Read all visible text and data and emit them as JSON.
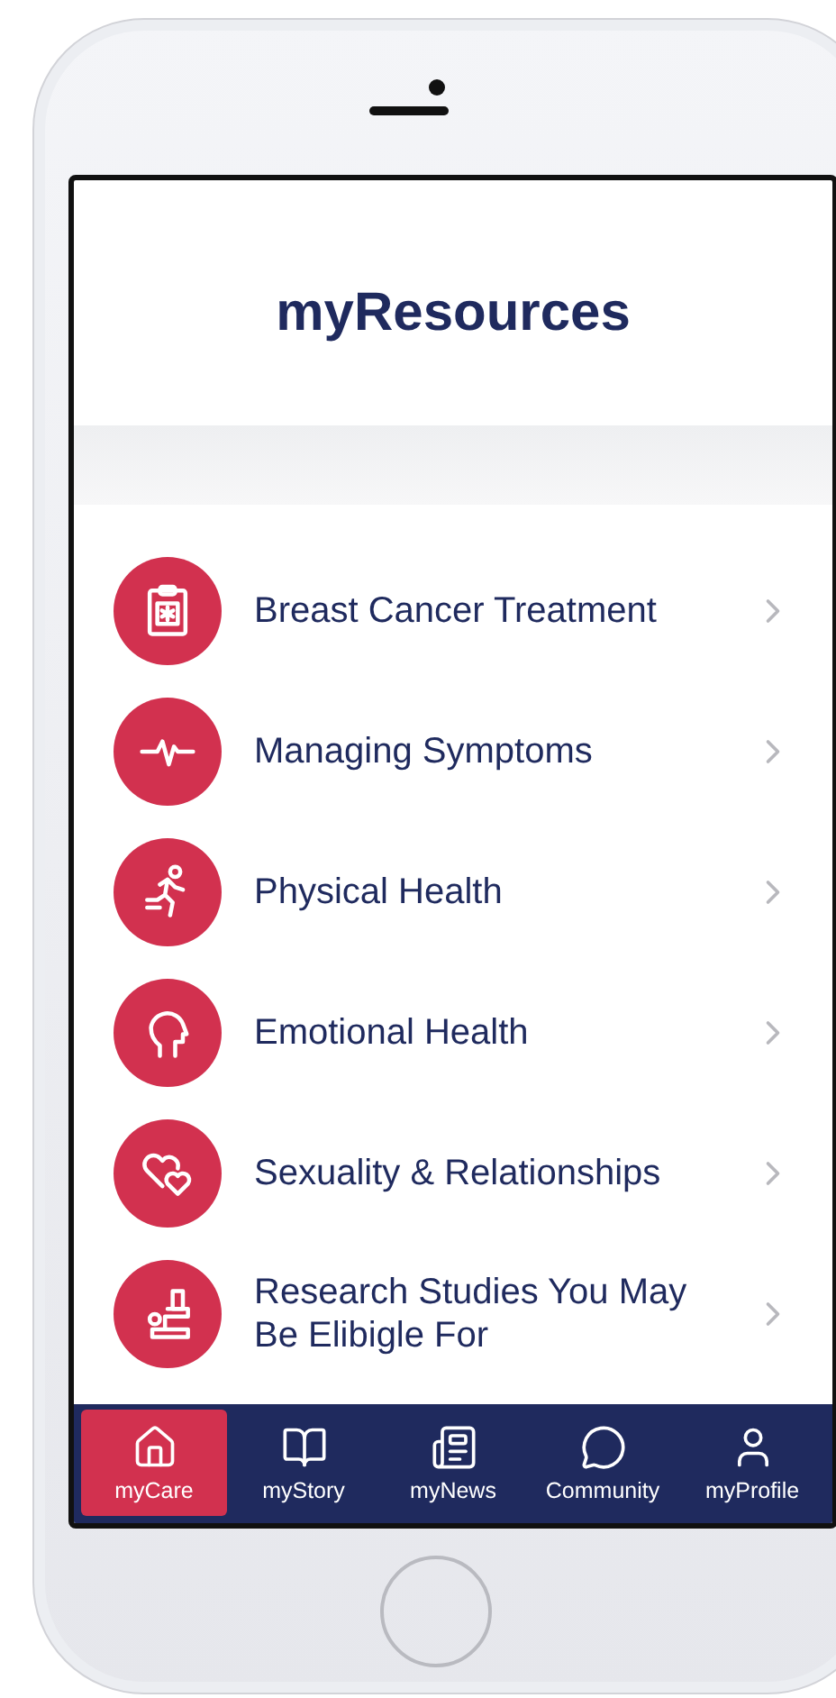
{
  "header": {
    "title": "myResources"
  },
  "resources": [
    {
      "kind": "clipboard",
      "label": "Breast Cancer Treatment"
    },
    {
      "kind": "pulse",
      "label": "Managing Symptoms"
    },
    {
      "kind": "runner",
      "label": "Physical Health"
    },
    {
      "kind": "head",
      "label": "Emotional Health"
    },
    {
      "kind": "hearts",
      "label": "Sexuality & Relationships"
    },
    {
      "kind": "microscope",
      "label": "Research Studies You May Be Elibigle For"
    }
  ],
  "tab_bar": [
    {
      "kind": "home",
      "label": "myCare",
      "selected": true
    },
    {
      "kind": "book",
      "label": "myStory",
      "selected": false
    },
    {
      "kind": "news",
      "label": "myNews",
      "selected": false
    },
    {
      "kind": "chat",
      "label": "Community",
      "selected": false
    },
    {
      "kind": "person",
      "label": "myProfile",
      "selected": false
    }
  ]
}
